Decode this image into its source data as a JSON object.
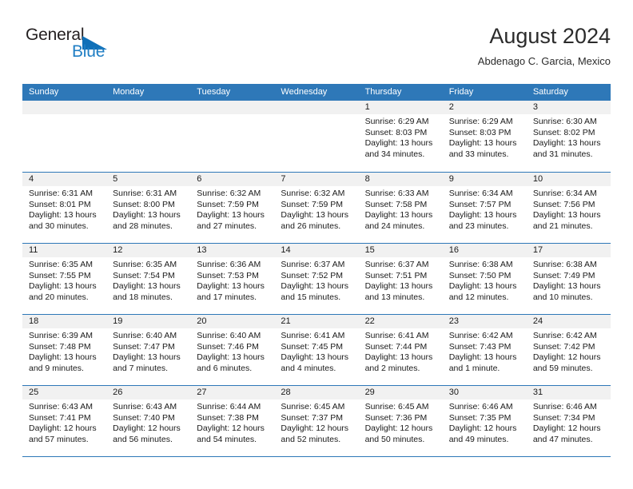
{
  "brand": {
    "word1": "General",
    "word2": "Blue",
    "triangle_icon": "triangle-icon",
    "color_dark": "#231f20",
    "color_blue": "#1f7ec4"
  },
  "header": {
    "title": "August 2024",
    "subtitle": "Abdenago C. Garcia, Mexico"
  },
  "theme": {
    "header_bg": "#2e78b8",
    "header_text": "#ffffff",
    "day_band_bg": "#f1f1f1",
    "grid_line": "#2e78b8"
  },
  "weekdays": [
    "Sunday",
    "Monday",
    "Tuesday",
    "Wednesday",
    "Thursday",
    "Friday",
    "Saturday"
  ],
  "weeks": [
    [
      {
        "day": "",
        "sunrise": "",
        "sunset": "",
        "daylight": "",
        "empty": true
      },
      {
        "day": "",
        "sunrise": "",
        "sunset": "",
        "daylight": "",
        "empty": true
      },
      {
        "day": "",
        "sunrise": "",
        "sunset": "",
        "daylight": "",
        "empty": true
      },
      {
        "day": "",
        "sunrise": "",
        "sunset": "",
        "daylight": "",
        "empty": true
      },
      {
        "day": "1",
        "sunrise": "Sunrise: 6:29 AM",
        "sunset": "Sunset: 8:03 PM",
        "daylight": "Daylight: 13 hours and 34 minutes."
      },
      {
        "day": "2",
        "sunrise": "Sunrise: 6:29 AM",
        "sunset": "Sunset: 8:03 PM",
        "daylight": "Daylight: 13 hours and 33 minutes."
      },
      {
        "day": "3",
        "sunrise": "Sunrise: 6:30 AM",
        "sunset": "Sunset: 8:02 PM",
        "daylight": "Daylight: 13 hours and 31 minutes."
      }
    ],
    [
      {
        "day": "4",
        "sunrise": "Sunrise: 6:31 AM",
        "sunset": "Sunset: 8:01 PM",
        "daylight": "Daylight: 13 hours and 30 minutes."
      },
      {
        "day": "5",
        "sunrise": "Sunrise: 6:31 AM",
        "sunset": "Sunset: 8:00 PM",
        "daylight": "Daylight: 13 hours and 28 minutes."
      },
      {
        "day": "6",
        "sunrise": "Sunrise: 6:32 AM",
        "sunset": "Sunset: 7:59 PM",
        "daylight": "Daylight: 13 hours and 27 minutes."
      },
      {
        "day": "7",
        "sunrise": "Sunrise: 6:32 AM",
        "sunset": "Sunset: 7:59 PM",
        "daylight": "Daylight: 13 hours and 26 minutes."
      },
      {
        "day": "8",
        "sunrise": "Sunrise: 6:33 AM",
        "sunset": "Sunset: 7:58 PM",
        "daylight": "Daylight: 13 hours and 24 minutes."
      },
      {
        "day": "9",
        "sunrise": "Sunrise: 6:34 AM",
        "sunset": "Sunset: 7:57 PM",
        "daylight": "Daylight: 13 hours and 23 minutes."
      },
      {
        "day": "10",
        "sunrise": "Sunrise: 6:34 AM",
        "sunset": "Sunset: 7:56 PM",
        "daylight": "Daylight: 13 hours and 21 minutes."
      }
    ],
    [
      {
        "day": "11",
        "sunrise": "Sunrise: 6:35 AM",
        "sunset": "Sunset: 7:55 PM",
        "daylight": "Daylight: 13 hours and 20 minutes."
      },
      {
        "day": "12",
        "sunrise": "Sunrise: 6:35 AM",
        "sunset": "Sunset: 7:54 PM",
        "daylight": "Daylight: 13 hours and 18 minutes."
      },
      {
        "day": "13",
        "sunrise": "Sunrise: 6:36 AM",
        "sunset": "Sunset: 7:53 PM",
        "daylight": "Daylight: 13 hours and 17 minutes."
      },
      {
        "day": "14",
        "sunrise": "Sunrise: 6:37 AM",
        "sunset": "Sunset: 7:52 PM",
        "daylight": "Daylight: 13 hours and 15 minutes."
      },
      {
        "day": "15",
        "sunrise": "Sunrise: 6:37 AM",
        "sunset": "Sunset: 7:51 PM",
        "daylight": "Daylight: 13 hours and 13 minutes."
      },
      {
        "day": "16",
        "sunrise": "Sunrise: 6:38 AM",
        "sunset": "Sunset: 7:50 PM",
        "daylight": "Daylight: 13 hours and 12 minutes."
      },
      {
        "day": "17",
        "sunrise": "Sunrise: 6:38 AM",
        "sunset": "Sunset: 7:49 PM",
        "daylight": "Daylight: 13 hours and 10 minutes."
      }
    ],
    [
      {
        "day": "18",
        "sunrise": "Sunrise: 6:39 AM",
        "sunset": "Sunset: 7:48 PM",
        "daylight": "Daylight: 13 hours and 9 minutes."
      },
      {
        "day": "19",
        "sunrise": "Sunrise: 6:40 AM",
        "sunset": "Sunset: 7:47 PM",
        "daylight": "Daylight: 13 hours and 7 minutes."
      },
      {
        "day": "20",
        "sunrise": "Sunrise: 6:40 AM",
        "sunset": "Sunset: 7:46 PM",
        "daylight": "Daylight: 13 hours and 6 minutes."
      },
      {
        "day": "21",
        "sunrise": "Sunrise: 6:41 AM",
        "sunset": "Sunset: 7:45 PM",
        "daylight": "Daylight: 13 hours and 4 minutes."
      },
      {
        "day": "22",
        "sunrise": "Sunrise: 6:41 AM",
        "sunset": "Sunset: 7:44 PM",
        "daylight": "Daylight: 13 hours and 2 minutes."
      },
      {
        "day": "23",
        "sunrise": "Sunrise: 6:42 AM",
        "sunset": "Sunset: 7:43 PM",
        "daylight": "Daylight: 13 hours and 1 minute."
      },
      {
        "day": "24",
        "sunrise": "Sunrise: 6:42 AM",
        "sunset": "Sunset: 7:42 PM",
        "daylight": "Daylight: 12 hours and 59 minutes."
      }
    ],
    [
      {
        "day": "25",
        "sunrise": "Sunrise: 6:43 AM",
        "sunset": "Sunset: 7:41 PM",
        "daylight": "Daylight: 12 hours and 57 minutes."
      },
      {
        "day": "26",
        "sunrise": "Sunrise: 6:43 AM",
        "sunset": "Sunset: 7:40 PM",
        "daylight": "Daylight: 12 hours and 56 minutes."
      },
      {
        "day": "27",
        "sunrise": "Sunrise: 6:44 AM",
        "sunset": "Sunset: 7:38 PM",
        "daylight": "Daylight: 12 hours and 54 minutes."
      },
      {
        "day": "28",
        "sunrise": "Sunrise: 6:45 AM",
        "sunset": "Sunset: 7:37 PM",
        "daylight": "Daylight: 12 hours and 52 minutes."
      },
      {
        "day": "29",
        "sunrise": "Sunrise: 6:45 AM",
        "sunset": "Sunset: 7:36 PM",
        "daylight": "Daylight: 12 hours and 50 minutes."
      },
      {
        "day": "30",
        "sunrise": "Sunrise: 6:46 AM",
        "sunset": "Sunset: 7:35 PM",
        "daylight": "Daylight: 12 hours and 49 minutes."
      },
      {
        "day": "31",
        "sunrise": "Sunrise: 6:46 AM",
        "sunset": "Sunset: 7:34 PM",
        "daylight": "Daylight: 12 hours and 47 minutes."
      }
    ]
  ]
}
